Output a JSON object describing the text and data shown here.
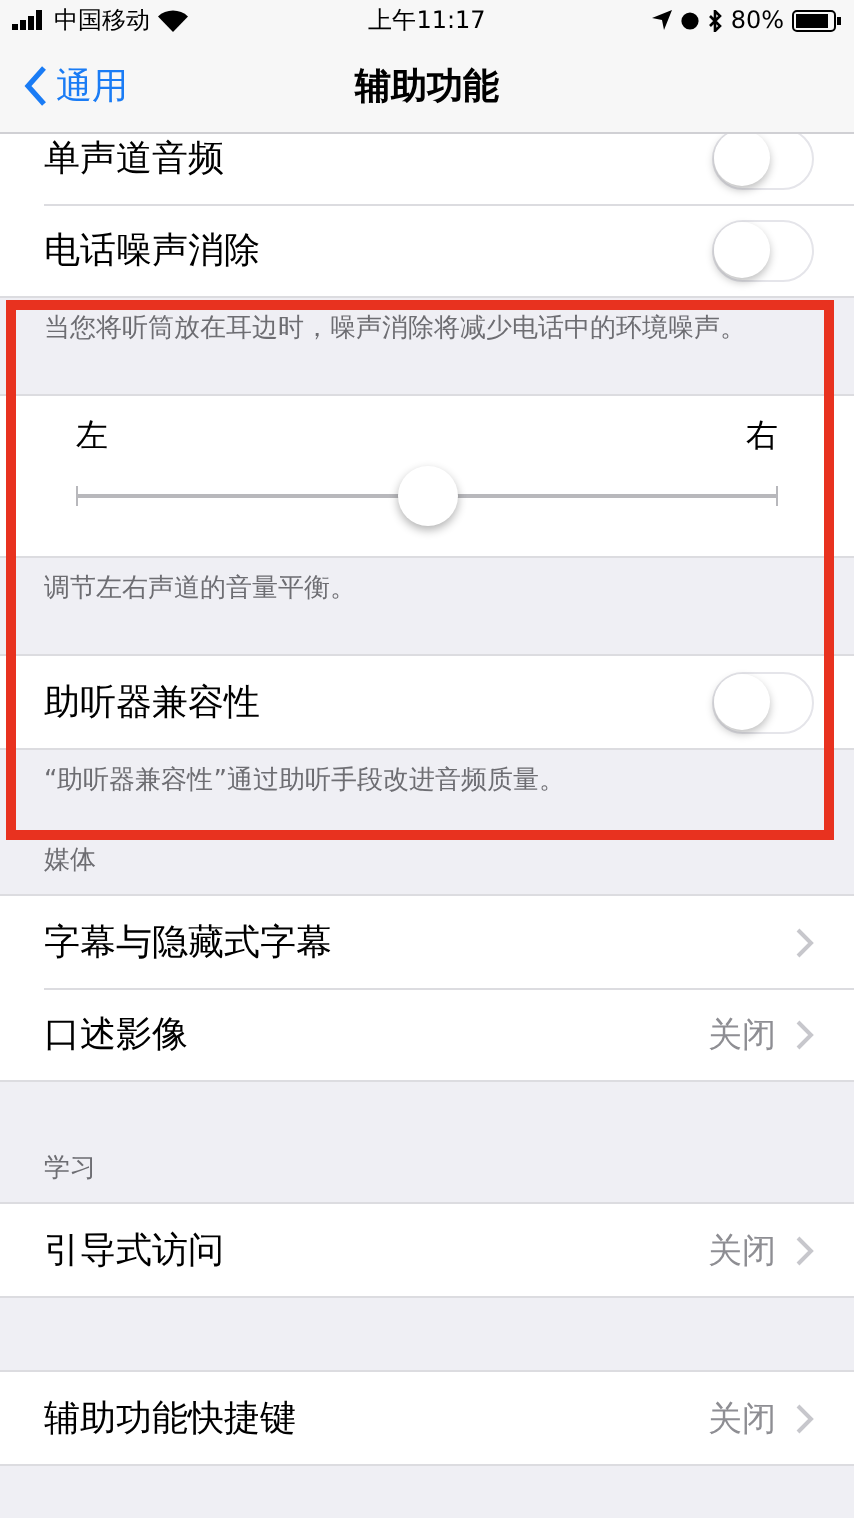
{
  "status_bar": {
    "carrier": "中国移动",
    "time": "上午11:17",
    "battery": "80%"
  },
  "nav": {
    "back": "通用",
    "title": "辅助功能"
  },
  "groups": [
    {
      "rows": [
        {
          "kind": "toggle",
          "label": "单声道音频",
          "on": false
        },
        {
          "kind": "toggle",
          "label": "电话噪声消除",
          "on": false
        }
      ],
      "footer": "当您将听筒放在耳边时，噪声消除将减少电话中的环境噪声。"
    },
    {
      "rows": [
        {
          "kind": "slider",
          "min_label": "左",
          "max_label": "右",
          "level": 0.5
        }
      ],
      "footer": "调节左右声道的音量平衡。"
    },
    {
      "rows": [
        {
          "kind": "toggle",
          "label": "助听器兼容性",
          "on": false
        }
      ],
      "footer": "“助听器兼容性”通过助听手段改进音频质量。"
    },
    {
      "header": "媒体",
      "rows": [
        {
          "kind": "link",
          "label": "字幕与隐藏式字幕"
        },
        {
          "kind": "link",
          "label": "口述影像",
          "value": "关闭"
        }
      ]
    },
    {
      "header": "学习",
      "rows": [
        {
          "kind": "link",
          "label": "引导式访问",
          "value": "关闭"
        }
      ]
    },
    {
      "rows": [
        {
          "kind": "link",
          "label": "辅助功能快捷键",
          "value": "关闭"
        }
      ]
    }
  ],
  "annotation": {
    "kind": "frame"
  }
}
